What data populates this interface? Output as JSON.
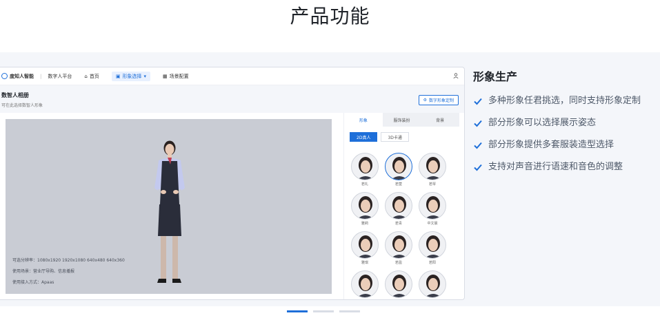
{
  "page": {
    "title": "产品功能"
  },
  "mock": {
    "brand": "度知人智能",
    "product": "数字人平台",
    "nav": [
      {
        "label": "首页",
        "active": false
      },
      {
        "label": "形象选择",
        "active": true
      },
      {
        "label": "场景配置",
        "active": false
      }
    ],
    "header_title": "数智人相册",
    "header_desc": "可在此选择数智人形象",
    "custom_button": "数字形象定制",
    "stage_info": [
      "可选分辨率：1080x1920 1920x1080 640x480 640x360",
      "使用场景：营业厅导购、信息播报",
      "使用接入方式：Apaas"
    ],
    "tabs": [
      {
        "label": "形象",
        "active": true
      },
      {
        "label": "服饰装扮",
        "active": false
      },
      {
        "label": "背景",
        "active": false
      }
    ],
    "filters": [
      {
        "label": "2D真人",
        "active": true
      },
      {
        "label": "3D卡通",
        "active": false
      }
    ],
    "avatars": [
      {
        "name": "若礼",
        "selected": false
      },
      {
        "name": "若萱",
        "selected": true
      },
      {
        "name": "若琴",
        "selected": false
      },
      {
        "name": "雅莉",
        "selected": false
      },
      {
        "name": "若青",
        "selected": false
      },
      {
        "name": "中文晨",
        "selected": false
      },
      {
        "name": "雅琪",
        "selected": false
      },
      {
        "name": "若盈",
        "selected": false
      },
      {
        "name": "若阳",
        "selected": false
      },
      {
        "name": "",
        "selected": false
      },
      {
        "name": "",
        "selected": false
      },
      {
        "name": "",
        "selected": false
      }
    ]
  },
  "feature": {
    "title": "形象生产",
    "items": [
      "多种形象任君挑选，同时支持形象定制",
      "部分形象可以选择展示姿态",
      "部分形象提供多套服装造型选择",
      "支持对声音进行语速和音色的调整"
    ]
  },
  "pager": {
    "count": 3,
    "active_index": 0
  },
  "colors": {
    "accent": "#1e6fd9",
    "band": "#f4f6fa",
    "stage": "#c9ccd4"
  }
}
